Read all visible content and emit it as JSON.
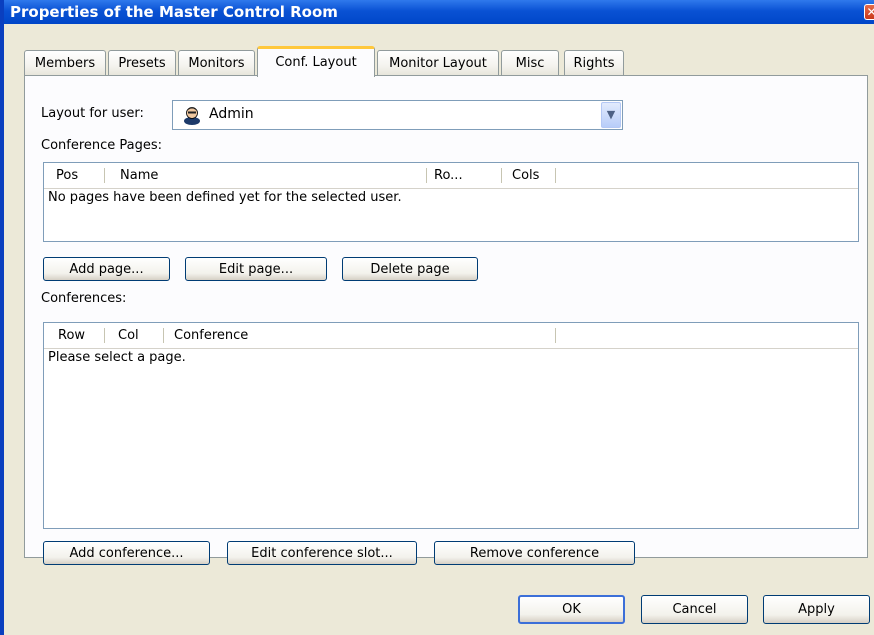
{
  "window": {
    "title": "Properties of the Master Control Room",
    "close_glyph": "✕"
  },
  "tabs": [
    {
      "label": "Members"
    },
    {
      "label": "Presets"
    },
    {
      "label": "Monitors"
    },
    {
      "label": "Conf. Layout",
      "active": true
    },
    {
      "label": "Monitor Layout"
    },
    {
      "label": "Misc"
    },
    {
      "label": "Rights"
    }
  ],
  "layout_for_user": {
    "label": "Layout for user:",
    "value": "Admin",
    "icon": "user-icon"
  },
  "conference_pages": {
    "label": "Conference Pages:",
    "columns": [
      "Pos",
      "Name",
      "Ro...",
      "Cols"
    ],
    "empty_message": "No pages have been defined yet for the selected user.",
    "buttons": {
      "add": "Add page...",
      "edit": "Edit page...",
      "delete": "Delete page"
    }
  },
  "conferences": {
    "label": "Conferences:",
    "columns": [
      "Row",
      "Col",
      "Conference"
    ],
    "empty_message": "Please select a page.",
    "buttons": {
      "add": "Add conference...",
      "edit": "Edit conference slot...",
      "remove": "Remove conference"
    }
  },
  "dialog_buttons": {
    "ok": "OK",
    "cancel": "Cancel",
    "apply": "Apply"
  },
  "colors": {
    "titlebar": "#0a52d4",
    "face": "#ece9d8",
    "active_tab_accent": "#ffc83c"
  }
}
